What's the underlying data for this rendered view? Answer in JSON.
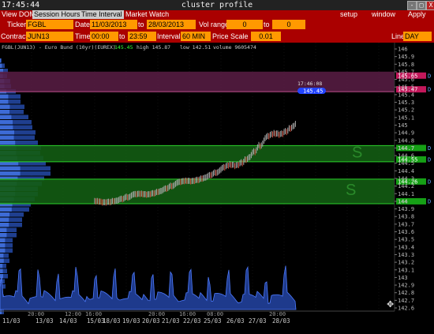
{
  "window": {
    "clock": "17:45:44",
    "title": "cluster profile",
    "btn_min": "-",
    "btn_max": "□",
    "btn_close": "X"
  },
  "menu": {
    "tabs": [
      "View DOM",
      "Session Hours",
      "Time Interval",
      "Market Watch"
    ],
    "right": [
      "setup",
      "window",
      "Apply"
    ]
  },
  "controls": {
    "ticker_label": "Ticker",
    "ticker": "FGBL",
    "date_label": "Date",
    "date_from": "11/03/2013",
    "to_label": "to",
    "date_to": "28/03/2013",
    "vol_label": "Vol range",
    "vol_from": "0",
    "vol_to_label": "to",
    "vol_to": "0",
    "contract_label": "Contract",
    "contract": "JUN13",
    "time_label": "Time",
    "time_from": "00:00",
    "time_to_label": "to",
    "time_to": "23:59",
    "interval_label": "Interval",
    "interval": "60 MIN",
    "scale_label": "Price Scale",
    "scale": "0.01",
    "line_label": "Line",
    "line": "DAY"
  },
  "chart_data": {
    "type": "table",
    "header": {
      "name": "FGBL(JUN13) - Euro Bund (10yr)(EUREX)",
      "last": "145.45",
      "high": "high 145.87",
      "low": "low 142.51",
      "volume": "volume 9605474"
    },
    "price_ticks": [
      "146",
      "145.9",
      "145.8",
      "145.7",
      "145.6",
      "145.5",
      "145.4",
      "145.3",
      "145.2",
      "145.1",
      "145",
      "144.9",
      "144.8",
      "144.7",
      "144.6",
      "144.5",
      "144.4",
      "144.3",
      "144.2",
      "144.1",
      "144",
      "143.9",
      "143.8",
      "143.7",
      "143.6",
      "143.5",
      "143.4",
      "143.3",
      "143.2",
      "143.1",
      "143",
      "142.9",
      "142.8",
      "142.7",
      "142.6"
    ],
    "ylim": [
      142.6,
      146.0
    ],
    "x_ticks": [
      "11/03",
      "13/03",
      "14/03",
      "15/03",
      "18/03",
      "19/03",
      "20/03",
      "21/03",
      "22/03",
      "25/03",
      "26/03",
      "27/03",
      "28/03"
    ],
    "time_ticks": [
      "20:00",
      "12:00",
      "16:00",
      "20:00",
      "16:00",
      "08:00",
      "20:00"
    ],
    "cursor_time": "17:46:08",
    "levels": [
      {
        "price": "145.65",
        "tag": "D",
        "color": "#8e2b6a",
        "kind": "resistance"
      },
      {
        "price": "145.47",
        "tag": "D",
        "color": "#8e2b6a",
        "kind": "resistance"
      },
      {
        "price": "145.45",
        "tag": "",
        "color": "#2244ff",
        "kind": "last"
      },
      {
        "price": "144.7",
        "tag": "D",
        "color": "#18a818",
        "kind": "support"
      },
      {
        "price": "144.55",
        "tag": "D",
        "color": "#18a818",
        "kind": "support"
      },
      {
        "price": "144.26",
        "tag": "D",
        "color": "#18a818",
        "kind": "support"
      },
      {
        "price": "144",
        "tag": "D",
        "color": "#18a818",
        "kind": "support"
      }
    ],
    "zone_labels": [
      "S",
      "S"
    ]
  }
}
